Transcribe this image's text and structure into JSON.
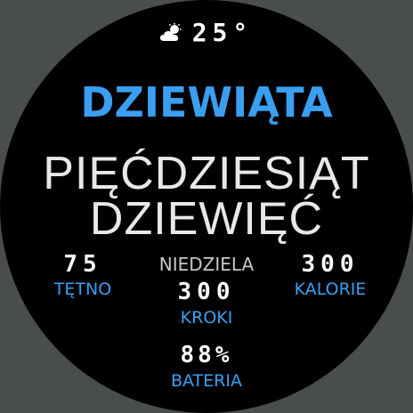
{
  "weather": {
    "icon": "partly-cloudy-icon",
    "temperature": "25°"
  },
  "time": {
    "hour_words": "DZIEWIĄTA",
    "minute_line_1": "PIĘĆDZIESIĄT",
    "minute_line_2": "DZIEWIĘĆ"
  },
  "day_of_week": "NIEDZIELA",
  "stats": {
    "heart_rate": {
      "value": "75",
      "label": "TĘTNO"
    },
    "calories": {
      "value": "300",
      "label": "KALORIE"
    },
    "steps": {
      "value": "300",
      "label": "KROKI"
    },
    "battery": {
      "value": "88%",
      "label": "BATERIA"
    }
  },
  "colors": {
    "accent": "#3a9ff0",
    "background": "#000000",
    "bezel": "#4a4e4a",
    "text": "#ffffff"
  }
}
